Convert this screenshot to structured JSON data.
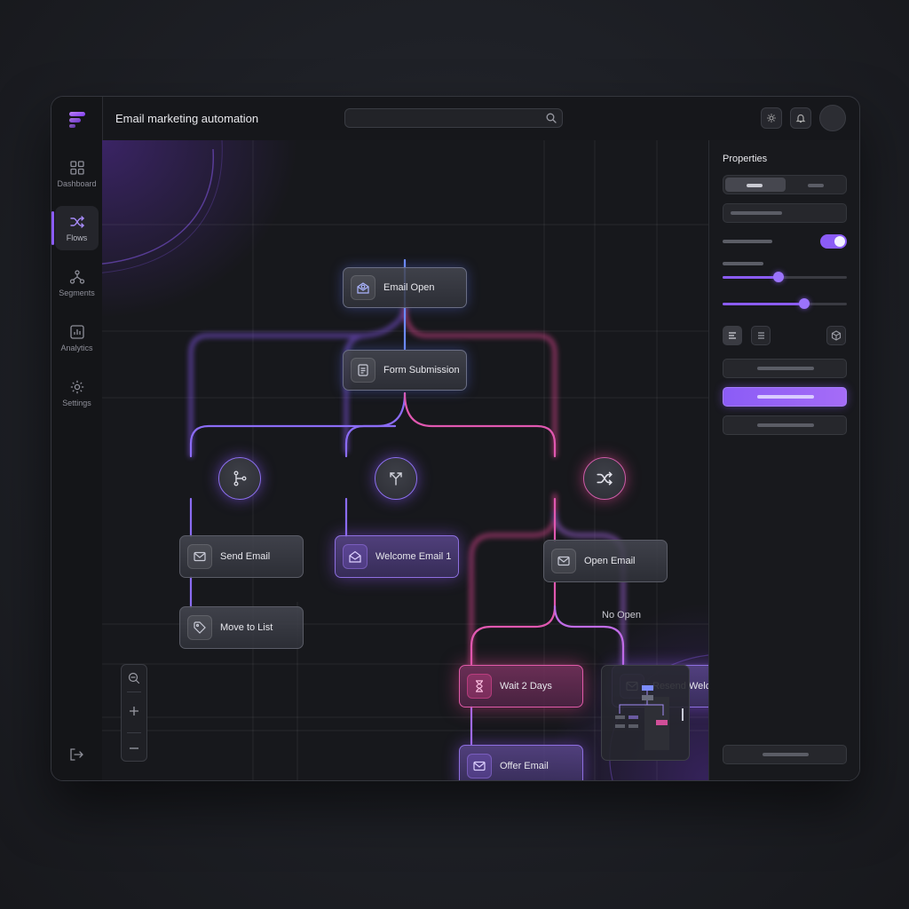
{
  "app": {
    "title": "Email marketing automation"
  },
  "search": {
    "value": "",
    "placeholder": ""
  },
  "sidebar": {
    "items": [
      {
        "label": "Dashboard",
        "icon": "grid-icon"
      },
      {
        "label": "Flows",
        "icon": "shuffle-icon",
        "active": true
      },
      {
        "label": "Segments",
        "icon": "network-icon"
      },
      {
        "label": "Analytics",
        "icon": "bar-chart-icon"
      },
      {
        "label": "Settings",
        "icon": "gear-icon"
      }
    ]
  },
  "flow": {
    "nodes": [
      {
        "id": "email-open",
        "label": "Email Open",
        "icon": "envelope-open-icon",
        "style": "blue"
      },
      {
        "id": "form-submission",
        "label": "Form Submission",
        "icon": "form-icon",
        "style": "blue"
      },
      {
        "id": "send-email",
        "label": "Send Email",
        "icon": "envelope-icon",
        "style": "neutral"
      },
      {
        "id": "move-to-list",
        "label": "Move to List",
        "icon": "tag-icon",
        "style": "neutral"
      },
      {
        "id": "welcome-email-1",
        "label": "Welcome Email 1",
        "icon": "envelope-open-icon",
        "style": "violet"
      },
      {
        "id": "open-email",
        "label": "Open Email",
        "icon": "envelope-icon",
        "style": "neutral"
      },
      {
        "id": "wait-2-days",
        "label": "Wait 2 Days",
        "icon": "hourglass-icon",
        "style": "pink"
      },
      {
        "id": "resend-welcome",
        "label": "Resend Welcome",
        "icon": "envelope-icon",
        "style": "violet"
      },
      {
        "id": "offer-email",
        "label": "Offer Email",
        "icon": "envelope-icon",
        "style": "violet"
      }
    ],
    "splits": [
      {
        "id": "branch",
        "icon": "git-branch-icon"
      },
      {
        "id": "merge",
        "icon": "split-icon"
      },
      {
        "id": "random",
        "icon": "shuffle-icon"
      }
    ],
    "edge_labels": {
      "no_open": "No Open"
    }
  },
  "properties": {
    "title": "Properties",
    "toggle_on": true,
    "slider_1": 0.45,
    "slider_2": 0.66
  },
  "colors": {
    "accent": "#8b5cf6",
    "pink": "#ec4899",
    "blue": "#6078ff"
  }
}
